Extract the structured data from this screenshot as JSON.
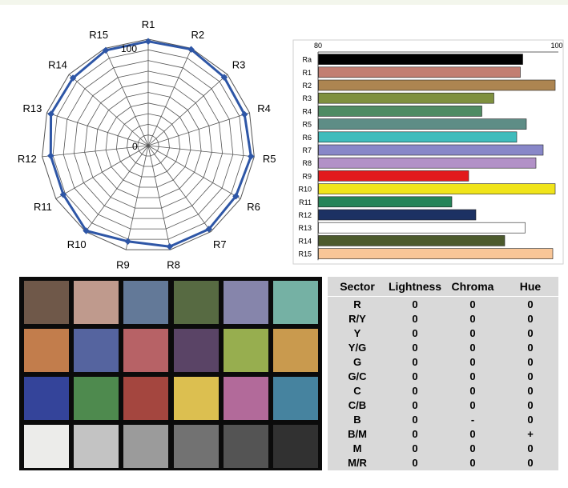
{
  "chart_data": [
    {
      "type": "radar",
      "title": "",
      "scale_labels": {
        "min": "0",
        "max": "100"
      },
      "ylim": [
        0,
        100
      ],
      "grid": true,
      "categories": [
        "R1",
        "R2",
        "R3",
        "R4",
        "R5",
        "R6",
        "R7",
        "R8",
        "R9",
        "R10",
        "R11",
        "R12",
        "R13",
        "R14",
        "R15"
      ],
      "values": [
        98,
        99,
        96,
        95,
        97,
        95,
        97,
        97,
        92,
        99,
        92,
        92,
        96,
        95,
        98
      ],
      "colors": {
        "series": "#2e56a6",
        "grid": "#555555"
      }
    },
    {
      "type": "bar",
      "orientation": "horizontal",
      "title": "",
      "xlim": [
        80,
        100
      ],
      "tick_labels": [
        "80",
        "100"
      ],
      "categories": [
        "Ra",
        "R1",
        "R2",
        "R3",
        "R4",
        "R5",
        "R6",
        "R7",
        "R8",
        "R9",
        "R10",
        "R11",
        "R12",
        "R13",
        "R14",
        "R15"
      ],
      "values": [
        97,
        96.8,
        99.7,
        94.6,
        93.6,
        97.3,
        96.5,
        98.7,
        98.1,
        92.5,
        99.7,
        91.1,
        93.1,
        97.2,
        95.5,
        99.5
      ],
      "colors": [
        "#000000",
        "#c27e72",
        "#ad8551",
        "#7f903f",
        "#4f8b63",
        "#5e8d86",
        "#3fbcbc",
        "#8887c8",
        "#b291c7",
        "#e2191c",
        "#f0e41a",
        "#258458",
        "#1c3163",
        "#ffffff",
        "#4c5a2d",
        "#f9c697"
      ]
    }
  ],
  "checker_colors": [
    [
      "#6f5849",
      "#bf9a8d",
      "#637998",
      "#576a42",
      "#8685ab",
      "#75b1a4"
    ],
    [
      "#c27d4c",
      "#55649f",
      "#b76266",
      "#5a4466",
      "#97ae4f",
      "#c99a4e"
    ],
    [
      "#34449a",
      "#4e8a4e",
      "#a4463f",
      "#dcbf50",
      "#b26a9a",
      "#46839f"
    ],
    [
      "#ececea",
      "#c3c3c3",
      "#9b9b9b",
      "#727272",
      "#545454",
      "#313131"
    ]
  ],
  "table": {
    "headers": [
      "Sector",
      "Lightness",
      "Chroma",
      "Hue"
    ],
    "rows": [
      [
        "R",
        "0",
        "0",
        "0"
      ],
      [
        "R/Y",
        "0",
        "0",
        "0"
      ],
      [
        "Y",
        "0",
        "0",
        "0"
      ],
      [
        "Y/G",
        "0",
        "0",
        "0"
      ],
      [
        "G",
        "0",
        "0",
        "0"
      ],
      [
        "G/C",
        "0",
        "0",
        "0"
      ],
      [
        "C",
        "0",
        "0",
        "0"
      ],
      [
        "C/B",
        "0",
        "0",
        "0"
      ],
      [
        "B",
        "0",
        "-",
        "0"
      ],
      [
        "B/M",
        "0",
        "0",
        "+"
      ],
      [
        "M",
        "0",
        "0",
        "0"
      ],
      [
        "M/R",
        "0",
        "0",
        "0"
      ]
    ]
  }
}
